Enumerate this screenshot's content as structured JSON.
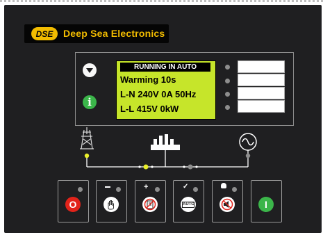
{
  "brand": {
    "name": "Deep Sea Electronics",
    "badge": "DSE",
    "color": "#f2bc00"
  },
  "display": {
    "header": "RUNNING IN AUTO",
    "lines": [
      "Warming 10s",
      "L-N  240V  0A  50Hz",
      "L-L  415V  0kW"
    ],
    "background": "#c6e52a"
  },
  "nav_buttons": [
    {
      "name": "scroll-down",
      "icon": "triangle-down-icon"
    },
    {
      "name": "info",
      "icon": "info-icon",
      "glyph": "i",
      "color": "#3bb54a"
    }
  ],
  "indicators": {
    "count": 4,
    "led_color": "#8e8e8e"
  },
  "mimic": {
    "mains_icon": "transmission-tower-icon",
    "load_icon": "factory-icon",
    "generator_icon": "ac-sine-icon",
    "active_led_color": "#e9ef2a"
  },
  "control_buttons": [
    {
      "name": "stop-reset",
      "icon": "stop-icon",
      "glyph": "O",
      "color": "#e2231a"
    },
    {
      "name": "manual",
      "icon": "hand-icon",
      "color": "#ffffff"
    },
    {
      "name": "test",
      "icon": "test-mode-icon",
      "color": "#ffffff"
    },
    {
      "name": "auto",
      "icon": "auto-icon",
      "glyph": "AUTO",
      "color": "#ffffff"
    },
    {
      "name": "alarm-mute",
      "icon": "alarm-mute-icon",
      "color": "#ffffff"
    },
    {
      "name": "start",
      "icon": "start-icon",
      "glyph": "I",
      "color": "#3bb54a"
    }
  ]
}
